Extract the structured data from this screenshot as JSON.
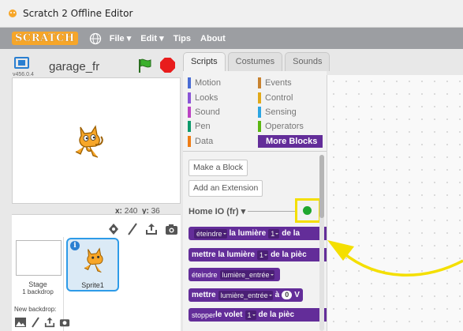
{
  "window": {
    "title": "Scratch 2 Offline Editor"
  },
  "menu": {
    "logo": "SCRATCH",
    "file": "File ▾",
    "edit": "Edit ▾",
    "tips": "Tips",
    "about": "About"
  },
  "stage": {
    "project_name": "garage_fr",
    "version": "v456.0.4"
  },
  "coords": {
    "x_label": "x:",
    "x_value": "240",
    "y_label": "y:",
    "y_value": "36"
  },
  "sprites": {
    "stage_label": "Stage",
    "backdrop_count": "1 backdrop",
    "new_backdrop": "New backdrop:",
    "sprite_name": "Sprite1"
  },
  "tabs": [
    "Scripts",
    "Costumes",
    "Sounds"
  ],
  "categories": [
    {
      "label": "Motion",
      "color": "#4a6cd4"
    },
    {
      "label": "Looks",
      "color": "#8a55d7"
    },
    {
      "label": "Sound",
      "color": "#bb42c3"
    },
    {
      "label": "Pen",
      "color": "#0e9a6c"
    },
    {
      "label": "Data",
      "color": "#ee7d16"
    },
    {
      "label": "Events",
      "color": "#c88330"
    },
    {
      "label": "Control",
      "color": "#e1a91a"
    },
    {
      "label": "Sensing",
      "color": "#2ca5e2"
    },
    {
      "label": "Operators",
      "color": "#5cb712"
    },
    {
      "label": "More Blocks",
      "color": "#632d99"
    }
  ],
  "palette": {
    "make_block": "Make a Block",
    "add_extension": "Add an Extension",
    "extension_title": "Home IO (fr) ▾"
  },
  "blocks": {
    "b1": {
      "w1": "éteindre",
      "w2": "la lumière",
      "n": "1",
      "w3": "de la"
    },
    "b2": {
      "w1": "mettre la lumière",
      "n": "1",
      "w2": "de la pièc"
    },
    "b3": {
      "w1": "éteindre",
      "w2": "lumière_entrée"
    },
    "b4": {
      "w1": "mettre",
      "w2": "lumière_entrée",
      "w3": "à",
      "n": "0",
      "w4": "V"
    },
    "b5": {
      "w1": "stopper",
      "w2": "le volet",
      "n": "1",
      "w3": "de la pièc"
    }
  },
  "colors": {
    "more_blocks": "#632d99",
    "led": "#1fa72e",
    "highlight": "#f4df00",
    "menubar": "#9c9ea2"
  }
}
